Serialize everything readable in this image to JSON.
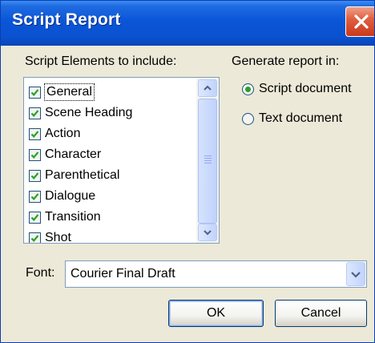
{
  "window": {
    "title": "Script Report"
  },
  "elements_section": {
    "label": "Script Elements to include:"
  },
  "elements": [
    {
      "label": "General",
      "checked": true,
      "focused": true
    },
    {
      "label": "Scene Heading",
      "checked": true
    },
    {
      "label": "Action",
      "checked": true
    },
    {
      "label": "Character",
      "checked": true
    },
    {
      "label": "Parenthetical",
      "checked": true
    },
    {
      "label": "Dialogue",
      "checked": true
    },
    {
      "label": "Transition",
      "checked": true
    },
    {
      "label": "Shot",
      "checked": true
    }
  ],
  "report_section": {
    "label": "Generate report in:",
    "options": [
      {
        "label": "Script document",
        "selected": true
      },
      {
        "label": "Text document",
        "selected": false
      }
    ]
  },
  "font": {
    "label": "Font:",
    "value": "Courier Final Draft"
  },
  "buttons": {
    "ok": "OK",
    "cancel": "Cancel"
  },
  "colors": {
    "titlebar": "#0a55d8",
    "dialog_bg": "#ece9d8",
    "check": "#2aa12a",
    "close": "#e06040"
  }
}
